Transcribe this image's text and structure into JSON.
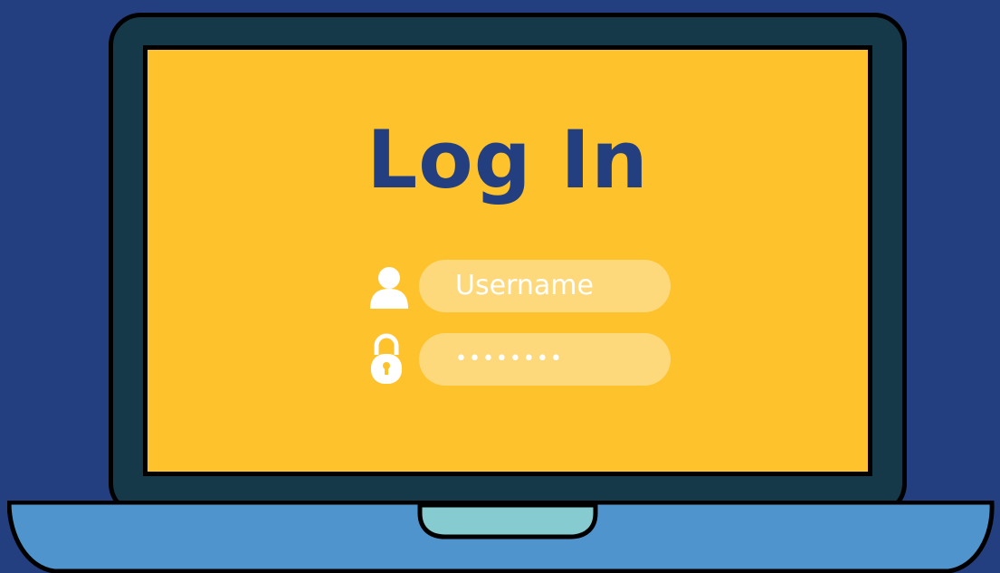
{
  "login": {
    "title": "Log In",
    "username_placeholder": "Username",
    "password_value": "••••••••"
  },
  "icons": {
    "user": "user-icon",
    "lock": "lock-icon"
  },
  "colors": {
    "background": "#233f7f",
    "screen": "#fec22c",
    "bezel": "#16394a",
    "laptop_base": "#4f94cc",
    "trackpad_notch": "#86cbd0",
    "title_text": "#233f7f"
  }
}
